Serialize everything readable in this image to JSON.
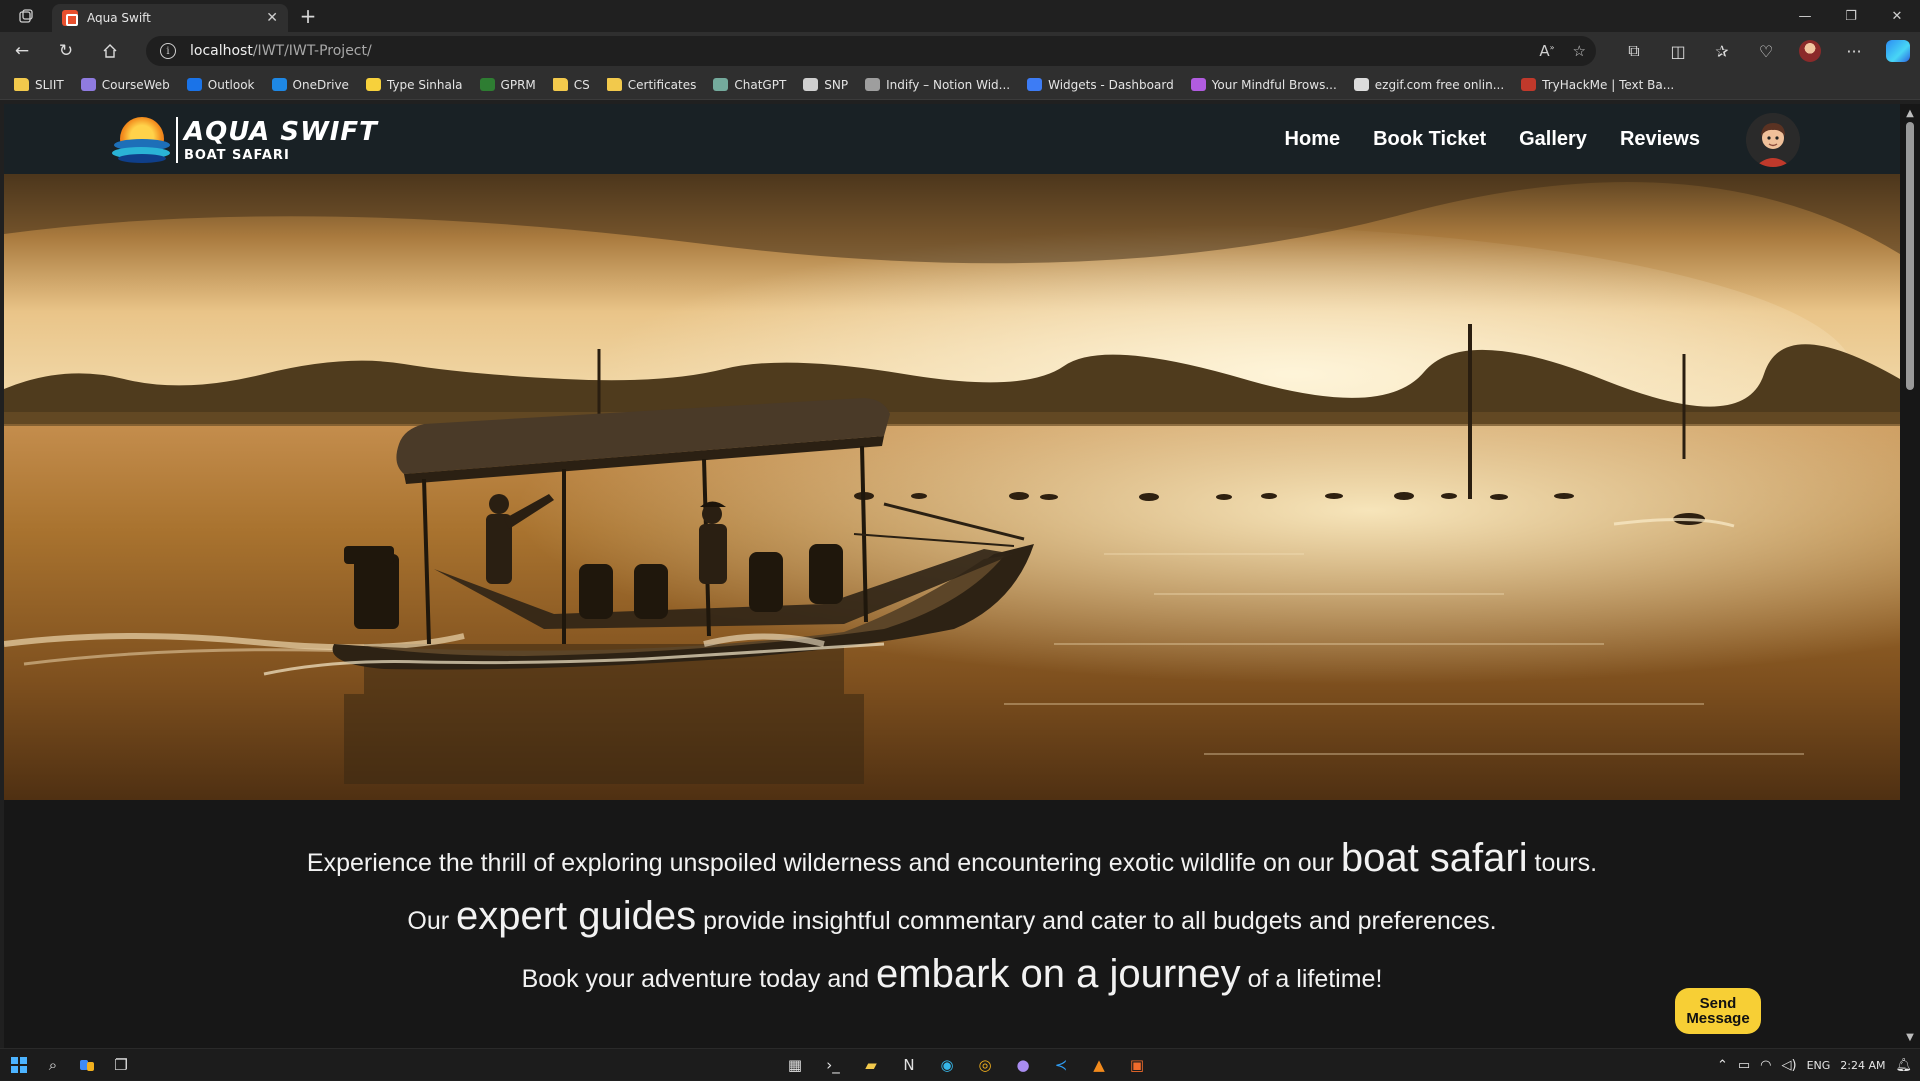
{
  "browser": {
    "tab_title": "Aqua Swift",
    "url_host": "localhost",
    "url_path": "/IWT/IWT-Project/",
    "bookmarks": [
      {
        "label": "SLIIT",
        "icon": "folder",
        "color": "#f2c94c"
      },
      {
        "label": "CourseWeb",
        "icon": "courseweb",
        "color": "#8f7be0"
      },
      {
        "label": "Outlook",
        "icon": "outlook",
        "color": "#1a73e8"
      },
      {
        "label": "OneDrive",
        "icon": "onedrive",
        "color": "#1e88e5"
      },
      {
        "label": "Type Sinhala",
        "icon": "type-sinhala",
        "color": "#f7d13c"
      },
      {
        "label": "GPRM",
        "icon": "gprm",
        "color": "#2e7d32"
      },
      {
        "label": "CS",
        "icon": "folder",
        "color": "#f2c94c"
      },
      {
        "label": "Certificates",
        "icon": "folder",
        "color": "#f2c94c"
      },
      {
        "label": "ChatGPT",
        "icon": "chatgpt",
        "color": "#74aa9c"
      },
      {
        "label": "SNP",
        "icon": "snp",
        "color": "#cfcfcf"
      },
      {
        "label": "Indify – Notion Wid...",
        "icon": "indify",
        "color": "#9e9e9e"
      },
      {
        "label": "Widgets - Dashboard",
        "icon": "widgets",
        "color": "#3d7cf5"
      },
      {
        "label": "Your Mindful Brows...",
        "icon": "mindful",
        "color": "#b15ce0"
      },
      {
        "label": "ezgif.com free onlin...",
        "icon": "ezgif",
        "color": "#dcdcdc"
      },
      {
        "label": "TryHackMe | Text Ba...",
        "icon": "tryhackme",
        "color": "#c0392b"
      }
    ]
  },
  "site": {
    "brand_title": "AQUA SWIFT",
    "brand_sub": "BOAT SAFARI",
    "nav": {
      "home": "Home",
      "book_ticket": "Book Ticket",
      "gallery": "Gallery",
      "reviews": "Reviews"
    },
    "intro": {
      "l1a": "Experience the thrill of exploring unspoiled wilderness and encountering exotic wildlife on our ",
      "l1b": "boat safari",
      "l1c": " tours.",
      "l2a": "Our ",
      "l2b": "expert guides",
      "l2c": " provide insightful commentary and cater to all budgets and preferences.",
      "l3a": "Book your adventure today and ",
      "l3b": "embark on a journey",
      "l3c": " of a lifetime!"
    },
    "send_message": "Send Message",
    "colors": {
      "header_bg": "#192125",
      "button_accent": "#f7cf35"
    }
  },
  "taskbar": {
    "language": "ENG",
    "time": "2:24 AM"
  }
}
